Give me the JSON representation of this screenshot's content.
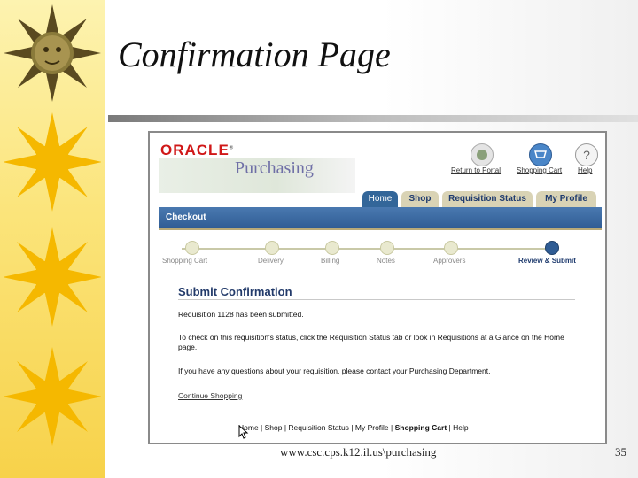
{
  "slide": {
    "title": "Confirmation Page",
    "footer_url": "www.csc.cps.k12.il.us\\purchasing",
    "page_number": "35"
  },
  "app": {
    "logo": "ORACLE",
    "product": "Purchasing",
    "global_links": [
      {
        "label": "Return to Portal",
        "icon": "portal-icon"
      },
      {
        "label": "Shopping Cart",
        "icon": "cart-icon"
      },
      {
        "label": "Help",
        "icon": "help-icon"
      }
    ],
    "tabs": [
      "Home",
      "Shop",
      "Requisition Status",
      "My Profile"
    ],
    "active_tab": "Home",
    "subbar": "Checkout",
    "train": [
      "Shopping Cart",
      "Delivery",
      "Billing",
      "Notes",
      "Approvers",
      "Review & Submit"
    ],
    "active_step": "Review & Submit"
  },
  "content": {
    "heading": "Submit Confirmation",
    "p1": "Requisition 1128 has been submitted.",
    "p2": "To check on this requisition's status, click the Requisition Status tab or look in Requisitions at a Glance on the Home page.",
    "p3": "If you have any questions about your requisition, please contact your Purchasing Department.",
    "link": "Continue Shopping",
    "bottom_nav": {
      "home": "Home",
      "shop": "Shop",
      "req_status": "Requisition Status",
      "profile": "My Profile",
      "cart": "Shopping Cart",
      "help": "Help",
      "sep": " | "
    }
  },
  "colors": {
    "accent_blue": "#2f5c94",
    "oracle_red": "#d01818",
    "tab_tan": "#d9d3b5"
  }
}
